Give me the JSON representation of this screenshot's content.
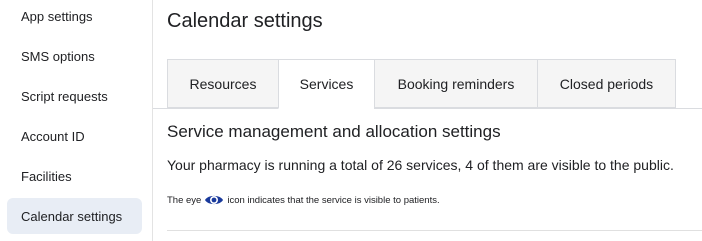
{
  "sidebar": {
    "items": [
      {
        "label": "App settings"
      },
      {
        "label": "SMS options"
      },
      {
        "label": "Script requests"
      },
      {
        "label": "Account ID"
      },
      {
        "label": "Facilities"
      },
      {
        "label": "Calendar settings",
        "active": true
      }
    ]
  },
  "main": {
    "title": "Calendar settings",
    "tabs": [
      {
        "label": "Resources"
      },
      {
        "label": "Services",
        "active": true
      },
      {
        "label": "Booking reminders"
      },
      {
        "label": "Closed periods"
      }
    ],
    "section_title": "Service management and allocation settings",
    "summary": "Your pharmacy is running a total of 26 services, 4 of them are visible to the public.",
    "eye_note_before": "The eye",
    "eye_note_after": "icon indicates that the service is visible to patients.",
    "eye_icon": "eye-icon",
    "eye_icon_color": "#1a3a9c"
  },
  "colors": {
    "active_sidebar_bg": "#e8edf5",
    "inactive_tab_bg": "#f5f5f5",
    "border": "#dadce0"
  }
}
